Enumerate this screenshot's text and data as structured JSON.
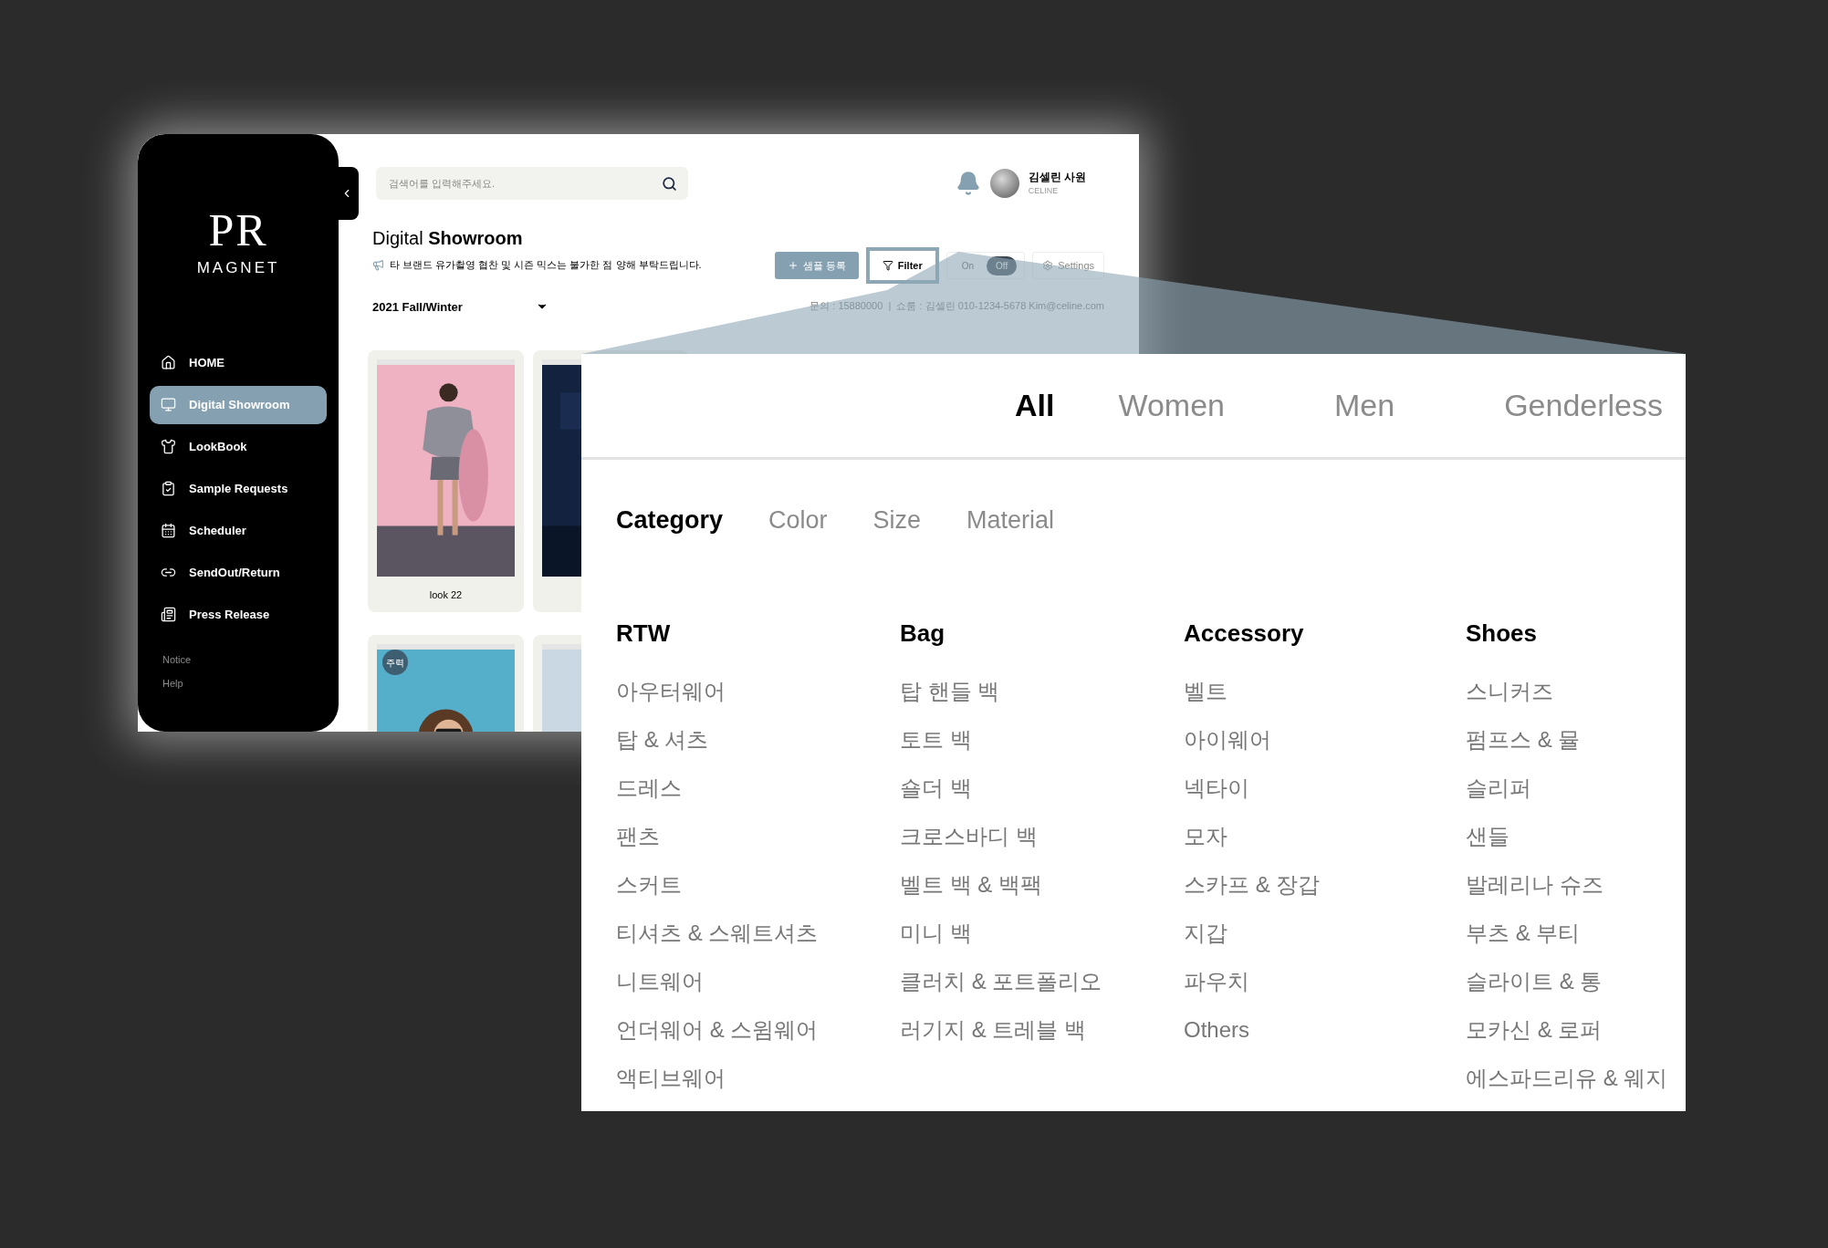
{
  "app": {
    "logo": {
      "mark": "PR",
      "wordmark": "MAGNET"
    },
    "sidebar": {
      "items": [
        {
          "label": "HOME",
          "selected": false
        },
        {
          "label": "Digital Showroom",
          "selected": true
        },
        {
          "label": "LookBook",
          "selected": false
        },
        {
          "label": "Sample Requests",
          "selected": false
        },
        {
          "label": "Scheduler",
          "selected": false
        },
        {
          "label": "SendOut/Return",
          "selected": false
        },
        {
          "label": "Press Release",
          "selected": false
        }
      ],
      "footer_links": [
        "Notice",
        "Help"
      ]
    },
    "search": {
      "placeholder": "검색어를 입력해주세요."
    },
    "user": {
      "name": "김셀린 사원",
      "brand": "CELINE"
    },
    "page_title": {
      "light": "Digital",
      "bold": "Showroom"
    },
    "notice": "타 브랜드 유가촬영 협찬 및 시즌 믹스는 불가한 점 양해 부탁드립니다.",
    "toolbar": {
      "add_button": "샘플 등록",
      "filter_button": {
        "label": "Filter",
        "expanded": true
      },
      "toggle": {
        "on_label": "On",
        "off_label": "Off",
        "on": false
      },
      "settings_button": "Settings"
    },
    "contact": "문의 : 15880000  |  쇼룸 : 김셀린 010-1234-5678 Kim@celine.com",
    "season_select": "2021 Fall/Winter",
    "cards": [
      {
        "kind": "picture",
        "label": "look 22"
      },
      {
        "kind": "picture"
      },
      {
        "kind": "picture",
        "badge": "주력"
      },
      {
        "kind": "picture"
      }
    ]
  },
  "filter_panel": {
    "audience_tabs": [
      {
        "label": "All",
        "selected": true
      },
      {
        "label": "Women",
        "selected": false
      },
      {
        "label": "Men",
        "selected": false
      },
      {
        "label": "Genderless",
        "selected": false
      }
    ],
    "facet_tabs": [
      {
        "label": "Category",
        "selected": true
      },
      {
        "label": "Color",
        "selected": false
      },
      {
        "label": "Size",
        "selected": false
      },
      {
        "label": "Material",
        "selected": false
      }
    ],
    "columns": [
      {
        "title": "RTW",
        "items": [
          "아우터웨어",
          "탑 & 셔츠",
          "드레스",
          "팬츠",
          "스커트",
          "티셔츠 & 스웨트셔츠",
          "니트웨어",
          "언더웨어 & 스윔웨어",
          "액티브웨어"
        ]
      },
      {
        "title": "Bag",
        "items": [
          "탑 핸들 백",
          "토트 백",
          "숄더 백",
          "크로스바디 백",
          "벨트 백 & 백팩",
          "미니 백",
          "클러치 & 포트폴리오",
          "러기지 & 트레블 백"
        ]
      },
      {
        "title": "Accessory",
        "items": [
          "벨트",
          "아이웨어",
          "넥타이",
          "모자",
          "스카프 & 장갑",
          "지갑",
          "파우치",
          "Others"
        ]
      },
      {
        "title": "Shoes",
        "items": [
          "스니커즈",
          "펌프스 & 뮬",
          "슬리퍼",
          "샌들",
          "발레리나 슈즈",
          "부츠 & 부티",
          "슬라이트 & 통",
          "모카신 & 로퍼",
          "에스파드리유 & 웨지"
        ]
      }
    ]
  }
}
